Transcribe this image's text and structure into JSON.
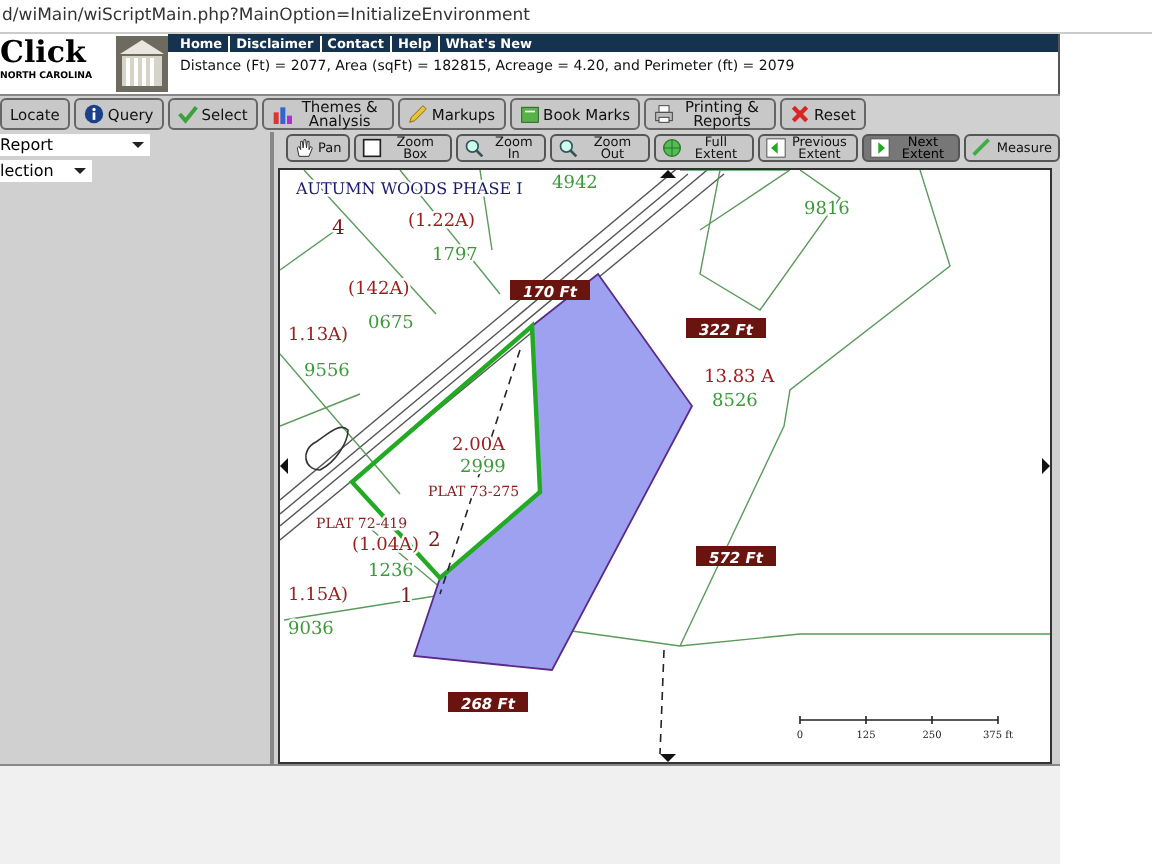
{
  "address_bar": {
    "url": "d/wiMain/wiScriptMain.php?MainOption=InitializeEnvironment"
  },
  "logo": {
    "title": "Click",
    "subtitle": "NORTH CAROLINA"
  },
  "nav_links": [
    "Home",
    "Disclaimer",
    "Contact",
    "Help",
    "What's New"
  ],
  "measure_result": "Distance (Ft) = 2077, Area (sqFt) = 182815, Acreage = 4.20, and Perimeter (ft) = 2079",
  "tabs": [
    {
      "label": "Locate"
    },
    {
      "label": "Query"
    },
    {
      "label": "Select"
    },
    {
      "label": "Themes & Analysis"
    },
    {
      "label": "Markups"
    },
    {
      "label": "Book Marks"
    },
    {
      "label": "Printing & Reports"
    },
    {
      "label": "Reset"
    }
  ],
  "sidebar": {
    "dropdowns": [
      {
        "value": "Report"
      },
      {
        "value": "lection"
      }
    ]
  },
  "map_tools": [
    {
      "label": "Pan",
      "pressed": false
    },
    {
      "label": "Zoom Box",
      "pressed": false
    },
    {
      "label": "Zoom In",
      "pressed": false
    },
    {
      "label": "Zoom Out",
      "pressed": false
    },
    {
      "label": "Full Extent",
      "pressed": false
    },
    {
      "label": "Previous Extent",
      "pressed": false
    },
    {
      "label": "Next Extent",
      "pressed": true
    },
    {
      "label": "Measure",
      "pressed": false
    }
  ],
  "map_labels": [
    {
      "text": "AUTUMN WOODS PHASE I",
      "kind": "subdivision"
    },
    {
      "text": "4",
      "kind": "lot"
    },
    {
      "text": "(1.22A)",
      "kind": "acreage"
    },
    {
      "text": "1797",
      "kind": "pin"
    },
    {
      "text": "4942",
      "kind": "pin"
    },
    {
      "text": "(142A)",
      "kind": "acreage"
    },
    {
      "text": "1.13A)",
      "kind": "acreage"
    },
    {
      "text": "0675",
      "kind": "pin"
    },
    {
      "text": "9556",
      "kind": "pin"
    },
    {
      "text": "9816",
      "kind": "pin"
    },
    {
      "text": "170 Ft",
      "kind": "dimension"
    },
    {
      "text": "322 Ft",
      "kind": "dimension"
    },
    {
      "text": "13.83 A",
      "kind": "acreage"
    },
    {
      "text": "8526",
      "kind": "pin"
    },
    {
      "text": "2.00A",
      "kind": "acreage"
    },
    {
      "text": "2999",
      "kind": "pin"
    },
    {
      "text": "PLAT 73-275",
      "kind": "plat"
    },
    {
      "text": "PLAT 72-419",
      "kind": "plat"
    },
    {
      "text": "(1.04A)",
      "kind": "acreage"
    },
    {
      "text": "2",
      "kind": "lot"
    },
    {
      "text": "1236",
      "kind": "pin"
    },
    {
      "text": "1.15A)",
      "kind": "acreage"
    },
    {
      "text": "1",
      "kind": "lot"
    },
    {
      "text": "9036",
      "kind": "pin"
    },
    {
      "text": "572 Ft",
      "kind": "dimension"
    },
    {
      "text": "268 Ft",
      "kind": "dimension"
    }
  ],
  "scale_bar": {
    "ticks": [
      "0",
      "125",
      "250",
      "375 ft"
    ]
  }
}
